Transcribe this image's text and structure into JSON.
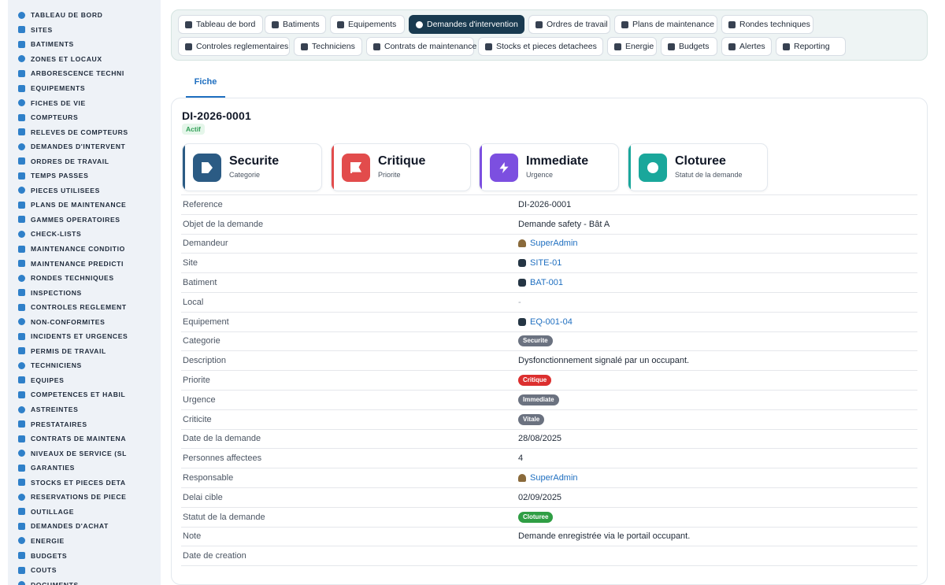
{
  "sidebar": {
    "items": [
      {
        "label": "TABLEAU DE BORD",
        "icon": "dashboard-icon"
      },
      {
        "label": "SITES",
        "icon": "map-pin-icon"
      },
      {
        "label": "BATIMENTS",
        "icon": "building-icon"
      },
      {
        "label": "ZONES ET LOCAUX",
        "icon": "grid-icon"
      },
      {
        "label": "ARBORESCENCE TECHNI",
        "icon": "tree-icon"
      },
      {
        "label": "EQUIPEMENTS",
        "icon": "gears-icon"
      },
      {
        "label": "FICHES DE VIE",
        "icon": "history-icon"
      },
      {
        "label": "COMPTEURS",
        "icon": "gauge-icon"
      },
      {
        "label": "RELEVES DE COMPTEURS",
        "icon": "clipboard-icon"
      },
      {
        "label": "DEMANDES D'INTERVENT",
        "icon": "question-icon"
      },
      {
        "label": "ORDRES DE TRAVAIL",
        "icon": "list-icon"
      },
      {
        "label": "TEMPS PASSES",
        "icon": "clock-icon"
      },
      {
        "label": "PIECES UTILISEES",
        "icon": "boxes-icon"
      },
      {
        "label": "PLANS DE MAINTENANCE",
        "icon": "calendar-icon"
      },
      {
        "label": "GAMMES OPERATOIRES",
        "icon": "layers-icon"
      },
      {
        "label": "CHECK-LISTS",
        "icon": "checklist-icon"
      },
      {
        "label": "MAINTENANCE CONDITIO",
        "icon": "thermometer-icon"
      },
      {
        "label": "MAINTENANCE PREDICTI",
        "icon": "chart-icon"
      },
      {
        "label": "RONDES TECHNIQUES",
        "icon": "route-icon"
      },
      {
        "label": "INSPECTIONS",
        "icon": "search-icon"
      },
      {
        "label": "CONTROLES REGLEMENT",
        "icon": "clipboard-check-icon"
      },
      {
        "label": "NON-CONFORMITES",
        "icon": "exclamation-icon"
      },
      {
        "label": "INCIDENTS ET URGENCES",
        "icon": "warning-icon"
      },
      {
        "label": "PERMIS DE TRAVAIL",
        "icon": "file-signature-icon"
      },
      {
        "label": "TECHNICIENS",
        "icon": "hard-hat-icon"
      },
      {
        "label": "EQUIPES",
        "icon": "users-icon"
      },
      {
        "label": "COMPETENCES ET HABIL",
        "icon": "certificate-icon"
      },
      {
        "label": "ASTREINTES",
        "icon": "phone-icon"
      },
      {
        "label": "PRESTATAIRES",
        "icon": "handshake-icon"
      },
      {
        "label": "CONTRATS DE MAINTENA",
        "icon": "file-contract-icon"
      },
      {
        "label": "NIVEAUX DE SERVICE (SL",
        "icon": "stopwatch-icon"
      },
      {
        "label": "GARANTIES",
        "icon": "shield-icon"
      },
      {
        "label": "STOCKS ET PIECES DETA",
        "icon": "warehouse-icon"
      },
      {
        "label": "RESERVATIONS DE PIECE",
        "icon": "bookmark-icon"
      },
      {
        "label": "OUTILLAGE",
        "icon": "tools-icon"
      },
      {
        "label": "DEMANDES D'ACHAT",
        "icon": "cart-icon"
      },
      {
        "label": "ENERGIE",
        "icon": "bolt-icon"
      },
      {
        "label": "BUDGETS",
        "icon": "wallet-icon"
      },
      {
        "label": "COUTS",
        "icon": "coins-icon"
      },
      {
        "label": "DOCUMENTS",
        "icon": "document-icon"
      }
    ]
  },
  "topnav": {
    "row1": [
      {
        "label": "Tableau de bord",
        "icon": "dashboard-icon"
      },
      {
        "label": "Batiments",
        "icon": "building-icon"
      },
      {
        "label": "Equipements",
        "icon": "gears-icon"
      },
      {
        "label": "Demandes d'intervention",
        "icon": "question-icon",
        "active": true
      },
      {
        "label": "Ordres de travail",
        "icon": "list-icon"
      },
      {
        "label": "Plans de maintenance",
        "icon": "calendar-icon"
      },
      {
        "label": "Rondes techniques",
        "icon": "route-icon"
      }
    ],
    "row2": [
      {
        "label": "Controles reglementaires",
        "icon": "clipboard-check-icon"
      },
      {
        "label": "Techniciens",
        "icon": "hard-hat-icon"
      },
      {
        "label": "Contrats de maintenance",
        "icon": "file-contract-icon"
      },
      {
        "label": "Stocks et pieces detachees",
        "icon": "boxes-icon"
      },
      {
        "label": "Energie",
        "icon": "bolt-icon"
      },
      {
        "label": "Budgets",
        "icon": "money-icon"
      },
      {
        "label": "Alertes",
        "icon": "bell-icon"
      },
      {
        "label": "Reporting",
        "icon": "pie-chart-icon"
      }
    ]
  },
  "tabs": {
    "fiche": "Fiche"
  },
  "record": {
    "reference": "DI-2026-0001",
    "status_pill": "Actif"
  },
  "kpis": [
    {
      "value": "Securite",
      "label": "Categorie",
      "color": "#2b5b84",
      "icon": "tag-icon"
    },
    {
      "value": "Critique",
      "label": "Priorite",
      "color": "#e24c4c",
      "icon": "flag-icon"
    },
    {
      "value": "Immediate",
      "label": "Urgence",
      "color": "#7c4fe0",
      "icon": "bolt-icon"
    },
    {
      "value": "Cloturee",
      "label": "Statut de la demande",
      "color": "#1aa79b",
      "icon": "info-icon"
    }
  ],
  "details": {
    "labels": {
      "reference": "Reference",
      "objet": "Objet de la demande",
      "demandeur": "Demandeur",
      "site": "Site",
      "batiment": "Batiment",
      "local": "Local",
      "equipement": "Equipement",
      "categorie": "Categorie",
      "description": "Description",
      "priorite": "Priorite",
      "urgence": "Urgence",
      "criticite": "Criticite",
      "date_demande": "Date de la demande",
      "personnes": "Personnes affectees",
      "responsable": "Responsable",
      "delai": "Delai cible",
      "statut": "Statut de la demande",
      "note": "Note",
      "date_creation": "Date de creation"
    },
    "values": {
      "reference": "DI-2026-0001",
      "objet": "Demande safety - Bât A",
      "demandeur": "SuperAdmin",
      "site": "SITE-01",
      "batiment": "BAT-001",
      "local": "-",
      "equipement": "EQ-001-04",
      "categorie": "Securite",
      "description": "Dysfonctionnement signalé par un occupant.",
      "priorite": "Critique",
      "urgence": "Immediate",
      "criticite": "Vitale",
      "date_demande": "28/08/2025",
      "personnes": "4",
      "responsable": "SuperAdmin",
      "delai": "02/09/2025",
      "statut": "Cloturee",
      "note": "Demande enregistrée via le portail occupant.",
      "date_creation": ""
    },
    "badge_colors": {
      "categorie": "#6b7280",
      "priorite": "#dc2f2f",
      "urgence": "#6b7280",
      "criticite": "#6b7280",
      "statut": "#2f9e44"
    }
  }
}
